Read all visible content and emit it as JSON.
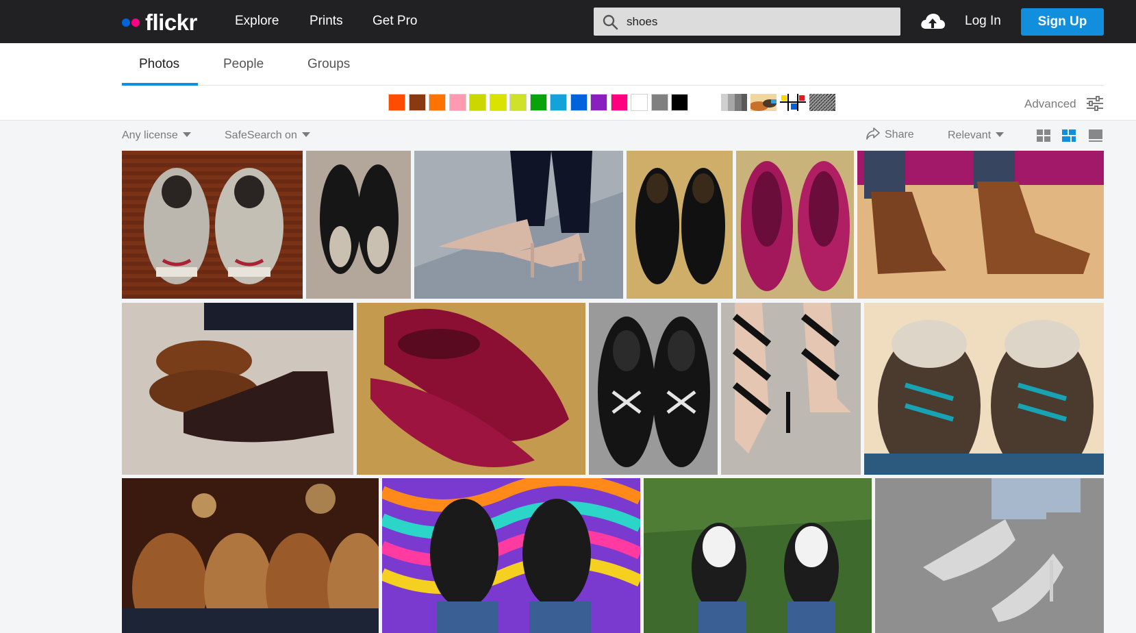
{
  "header": {
    "brand": "flickr",
    "nav": [
      "Explore",
      "Prints",
      "Get Pro"
    ],
    "search_value": "shoes",
    "login_label": "Log In",
    "signup_label": "Sign Up",
    "colors": {
      "bar": "#212124",
      "signup": "#128fdc",
      "dot_blue": "#0063dc",
      "dot_pink": "#ff0084"
    }
  },
  "tabs": [
    {
      "label": "Photos",
      "active": true
    },
    {
      "label": "People",
      "active": false
    },
    {
      "label": "Groups",
      "active": false
    }
  ],
  "color_filters": [
    "#ff4c00",
    "#8a3a12",
    "#ff7300",
    "#ff9ab0",
    "#ccd600",
    "#d9e200",
    "#cfe12a",
    "#08a20d",
    "#14a3d9",
    "#0063dc",
    "#8a1fbf",
    "#ff0080",
    "#ffffff",
    "#808080",
    "#000000"
  ],
  "style_filters": [
    "black-and-white-icon",
    "shallow-depth-of-field-icon",
    "minimalist-icon",
    "patterns-icon"
  ],
  "advanced_label": "Advanced",
  "filters": {
    "license": "Any license",
    "safesearch": "SafeSearch on",
    "share": "Share",
    "sort": "Relevant"
  },
  "photos": [
    "grey-sneakers",
    "black-oxfords",
    "nude-heels",
    "black-leather-shoes",
    "pink-flats",
    "brown-boots",
    "brown-loafers",
    "red-satin-flats",
    "black-vans",
    "black-strappy-heels",
    "brown-sneakers-teal-laces",
    "wingtip-shoes",
    "psychedelic-boots",
    "converse-grass",
    "silver-heels"
  ]
}
